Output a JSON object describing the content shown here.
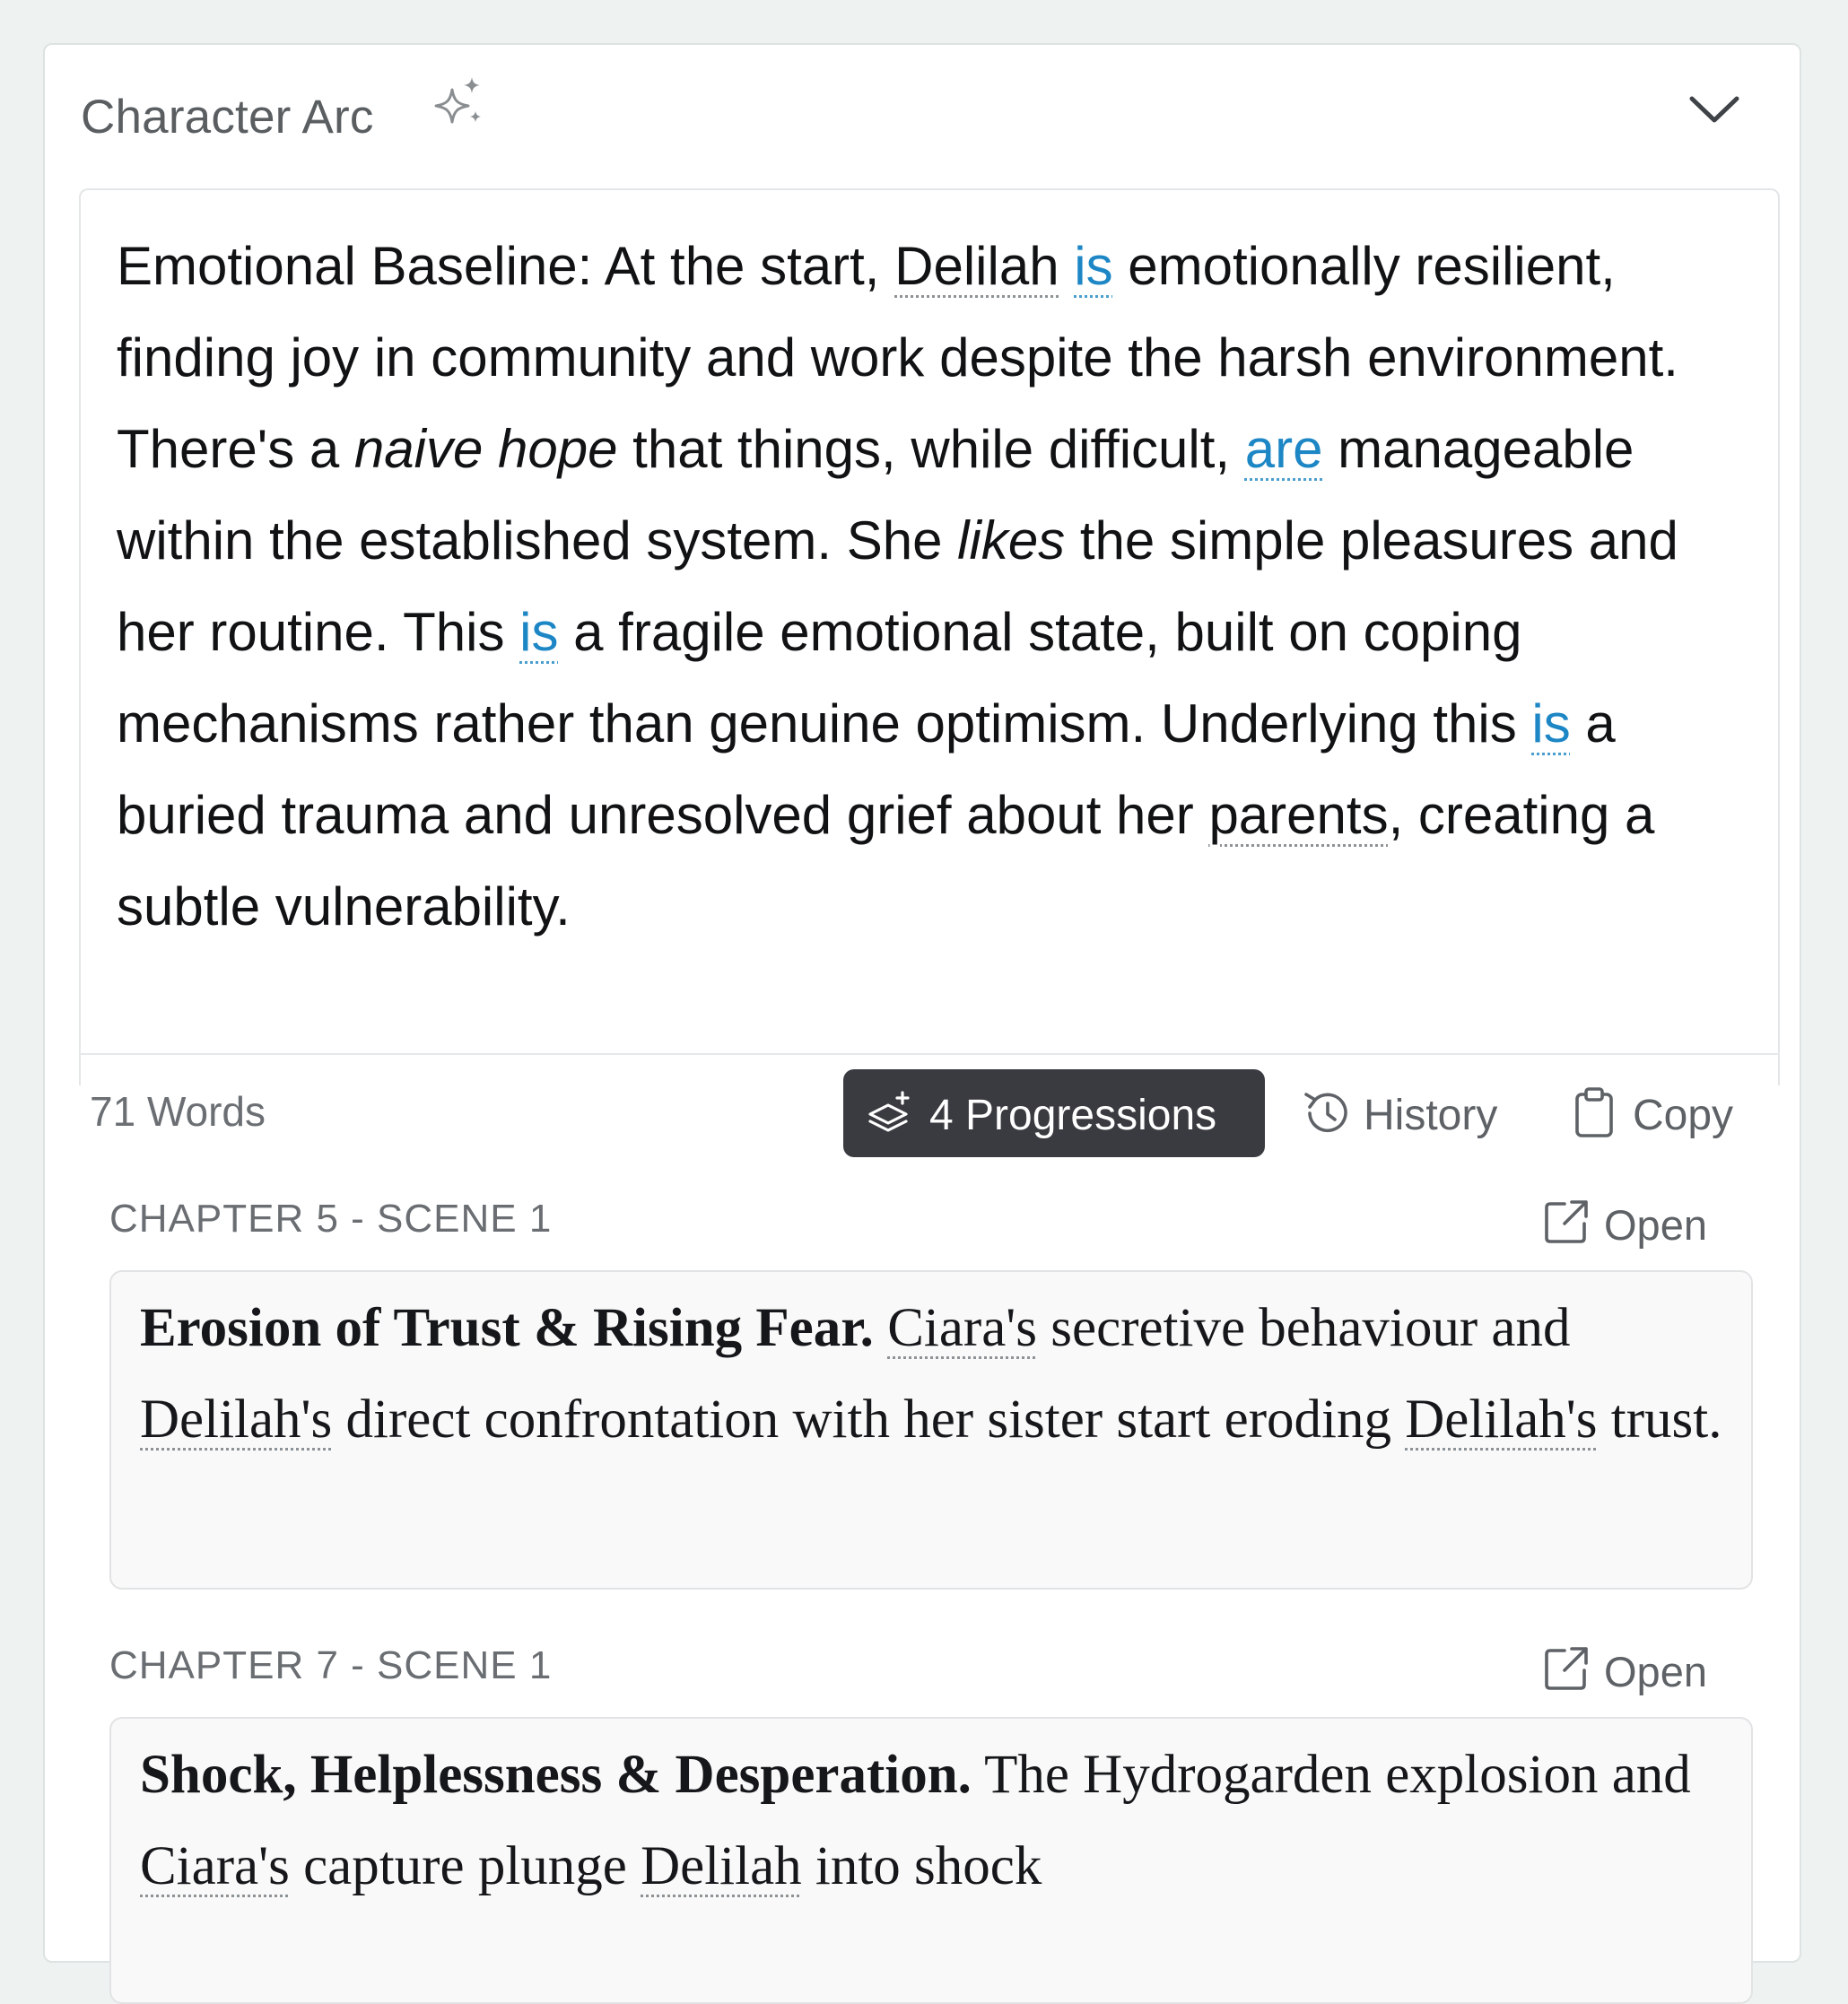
{
  "panel": {
    "title": "Character Arc",
    "title_icon": "sparkle-icon",
    "collapse_icon": "chevron-down-icon"
  },
  "arc": {
    "segments": [
      {
        "text": "Emotional Baseline: At the start, ",
        "style": "plain"
      },
      {
        "text": "Delilah",
        "style": "ul"
      },
      {
        "text": " ",
        "style": "plain"
      },
      {
        "text": "is",
        "style": "hl"
      },
      {
        "text": " emotionally resilient, finding joy in community and work despite the harsh environment. There's a ",
        "style": "plain"
      },
      {
        "text": "naive hope",
        "style": "em"
      },
      {
        "text": " that things, while difficult, ",
        "style": "plain"
      },
      {
        "text": "are",
        "style": "hl"
      },
      {
        "text": " manageable within the established system. She ",
        "style": "plain"
      },
      {
        "text": "likes",
        "style": "em"
      },
      {
        "text": " the simple pleasures and her routine. This ",
        "style": "plain"
      },
      {
        "text": "is",
        "style": "hl"
      },
      {
        "text": " a fragile emotional state, built on coping mechanisms rather than genuine optimism. Underlying this ",
        "style": "plain"
      },
      {
        "text": "is",
        "style": "hl"
      },
      {
        "text": " a buried trauma and unresolved grief about her ",
        "style": "plain"
      },
      {
        "text": "parents",
        "style": "ul"
      },
      {
        "text": ", creating a subtle vulnerability.",
        "style": "plain"
      }
    ]
  },
  "toolbar": {
    "word_count": "71 Words",
    "progressions_label": "4 Progressions",
    "history_label": "History",
    "copy_label": "Copy"
  },
  "progressions": [
    {
      "scene": "CHAPTER 5 - SCENE 1",
      "open_label": "Open",
      "segments": [
        {
          "text": "Erosion of Trust & Rising Fear.",
          "style": "title"
        },
        {
          "text": " ",
          "style": "plain"
        },
        {
          "text": "Ciara's",
          "style": "ul"
        },
        {
          "text": " secretive behaviour and ",
          "style": "plain"
        },
        {
          "text": "Delilah's",
          "style": "ul"
        },
        {
          "text": " direct confrontation with her sister start eroding ",
          "style": "plain"
        },
        {
          "text": "Delilah's",
          "style": "ul"
        },
        {
          "text": " trust.",
          "style": "plain"
        }
      ]
    },
    {
      "scene": "CHAPTER 7 - SCENE 1",
      "open_label": "Open",
      "segments": [
        {
          "text": "Shock, Helplessness & Desperation.",
          "style": "title"
        },
        {
          "text": " The Hydrogarden explosion and ",
          "style": "plain"
        },
        {
          "text": "Ciara's",
          "style": "ul"
        },
        {
          "text": " capture plunge ",
          "style": "plain"
        },
        {
          "text": "Delilah",
          "style": "ul"
        },
        {
          "text": " into shock",
          "style": "plain"
        }
      ]
    }
  ]
}
